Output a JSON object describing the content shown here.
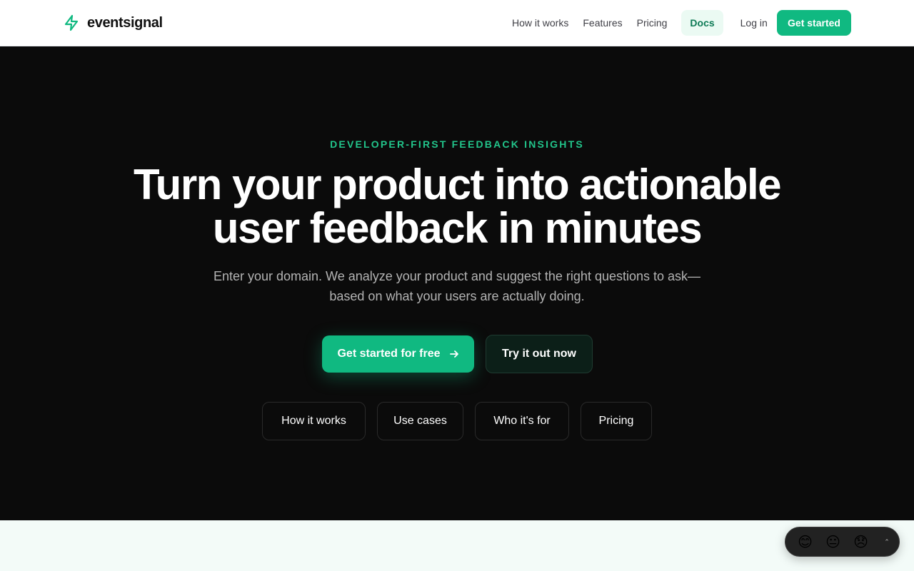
{
  "brand": {
    "name": "eventsignal",
    "icon": "bolt-icon",
    "accent_color": "#10b981"
  },
  "nav": {
    "links": [
      {
        "label": "How it works"
      },
      {
        "label": "Features"
      },
      {
        "label": "Pricing"
      },
      {
        "label": "Docs"
      }
    ],
    "login_label": "Log in",
    "cta_label": "Get started"
  },
  "hero": {
    "eyebrow": "DEVELOPER-FIRST FEEDBACK INSIGHTS",
    "title": "Turn your product into actionable user feedback in minutes",
    "subtitle": "Enter your domain. We analyze your product and suggest the right questions to ask—based on what your users are actually doing.",
    "primary_cta": "Get started for free",
    "primary_cta_icon": "arrow-right-icon",
    "secondary_cta": "Try it out now",
    "pills": [
      {
        "label": "How it works"
      },
      {
        "label": "Use cases"
      },
      {
        "label": "Who it's for"
      },
      {
        "label": "Pricing"
      }
    ]
  },
  "feedback_widget": {
    "happy": "😊",
    "neutral": "😐",
    "sad": "😞",
    "toggle": "⌃"
  }
}
